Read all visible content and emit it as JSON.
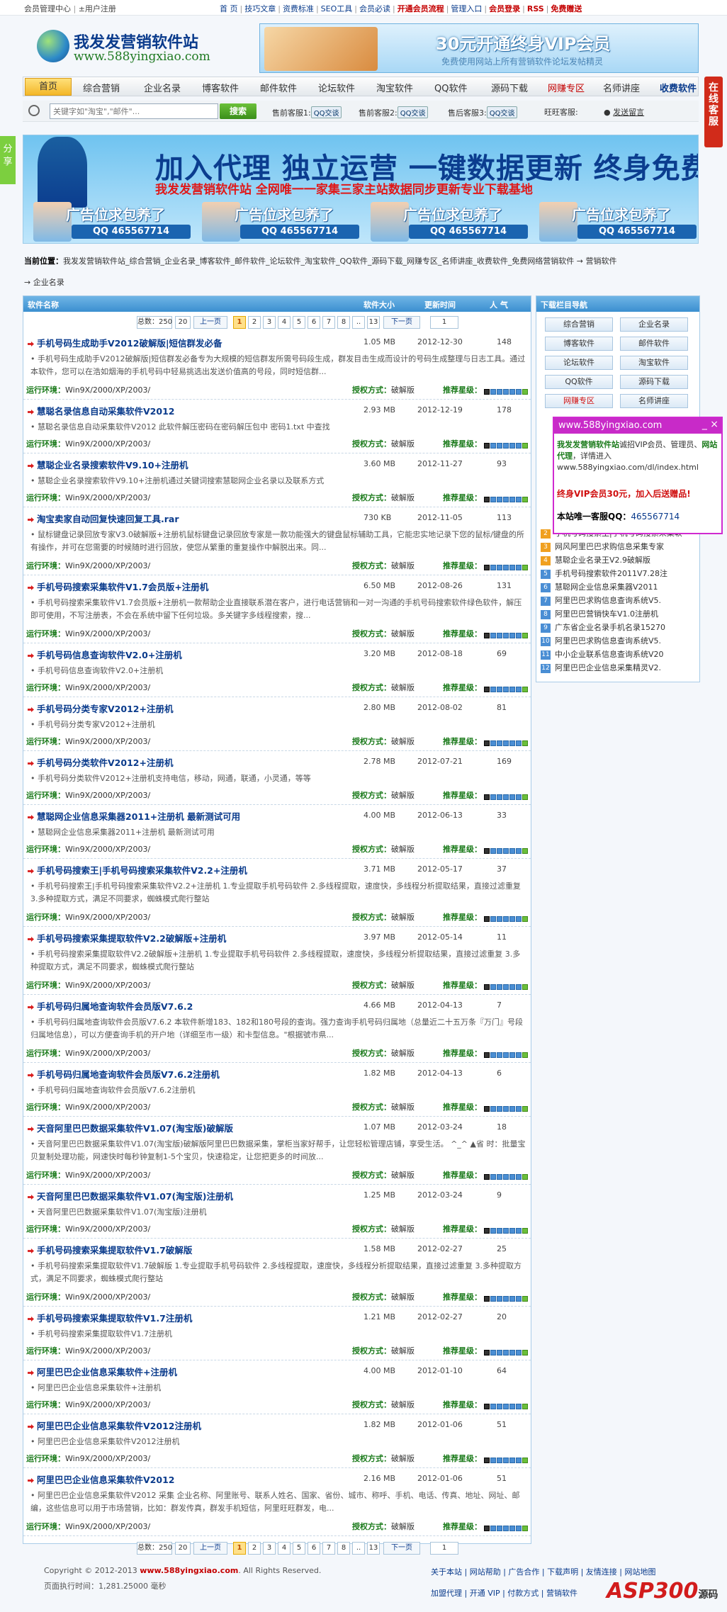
{
  "topbar": {
    "member_center": "会员管理中心",
    "register": "±用户注册",
    "links": [
      "首 页",
      "技巧文章",
      "资费标准",
      "SEO工具",
      "会员必读",
      "开通会员流程",
      "管理入口",
      "会员登录",
      "RSS",
      "免费赠送"
    ]
  },
  "logo": {
    "title": "我发发营销软件站",
    "url": "www.588yingxiao.com"
  },
  "vip_banner": {
    "headline": "30元开通终身VIP会员",
    "sub": "免费使用网站上所有营销软件论坛发帖精灵"
  },
  "nav": [
    "首页",
    "综合营销",
    "企业名录",
    "博客软件",
    "邮件软件",
    "论坛软件",
    "淘宝软件",
    "QQ软件",
    "源码下载",
    "网赚专区",
    "名师讲座",
    "收费软件"
  ],
  "search": {
    "placeholder": "关键字如\"淘宝\",\"邮件\"...",
    "button": "搜索"
  },
  "service": {
    "pre_sale1": "售前客服1:",
    "pre_sale2": "售前客服2:",
    "after_sale": "售后客服3:",
    "wangwang": "旺旺客服:",
    "qq_label": "QQ交谈",
    "leave_msg": "发送留言"
  },
  "side_float": "在线客服",
  "share": "分享",
  "big_ad": {
    "headline": "加入代理 独立运营 一键数据更新 终身免费",
    "sub": "我发发营销软件站 全网唯一一家集三家主站数据同步更新专业下载基地",
    "cells": [
      {
        "title": "广告位求包养了",
        "qq": "QQ 465567714"
      },
      {
        "title": "广告位求包养了",
        "qq": "QQ 465567714"
      },
      {
        "title": "广告位求包养了",
        "qq": "QQ 465567714"
      },
      {
        "title": "广告位求包养了",
        "qq": "QQ 465567714"
      }
    ]
  },
  "breadcrumb": {
    "label": "当前位置：",
    "path": "我发发营销软件站_综合营销_企业名录_博客软件_邮件软件_论坛软件_淘宝软件_QQ软件_源码下载_网赚专区_名师讲座_收费软件_免费网络营销软件 → 营销软件",
    "leaf": "→ 企业名录"
  },
  "list_header": {
    "name": "软件名称",
    "size": "软件大小",
    "time": "更新时间",
    "hits": "人 气"
  },
  "pager": {
    "total": "总数：250",
    "per": "20",
    "prev": "上一页",
    "pages": [
      "1",
      "2",
      "3",
      "4",
      "5",
      "6",
      "7",
      "8",
      "..",
      "13"
    ],
    "next": "下一页",
    "goto": "1"
  },
  "row_labels": {
    "env": "运行环境：",
    "auth": "授权方式：",
    "auth_value": "破解版",
    "rating": "推荐星级："
  },
  "items": [
    {
      "title": "手机号码生成助手V2012破解版|短信群发必备",
      "size": "1.05 MB",
      "date": "2012-12-30",
      "hits": "148",
      "desc": "• 手机号码生成助手V2012破解版|短信群发必备专为大规模的短信群发所需号码段生成，群发目击生成而设计的号码生成整理与日志工具。通过本软件，您可以在浩如烟海的手机号码中轻易挑选出发送价值高的号段，同时短信群...",
      "env": "Win9X/2000/XP/2003/"
    },
    {
      "title": "慧聪名录信息自动采集软件V2012",
      "size": "2.93 MB",
      "date": "2012-12-19",
      "hits": "178",
      "desc": "• 慧聪名录信息自动采集软件V2012 此软件解压密码在密码解压包中 密码1.txt 中查找",
      "env": "Win9X/2000/XP/2003/"
    },
    {
      "title": "慧聪企业名录搜索软件V9.10+注册机",
      "size": "3.60 MB",
      "date": "2012-11-27",
      "hits": "93",
      "desc": "• 慧聪企业名录搜索软件V9.10+注册机通过关键词搜索慧聪网企业名录以及联系方式",
      "env": "Win9X/2000/XP/2003/"
    },
    {
      "title": "淘宝卖家自动回复快速回复工具.rar",
      "size": "730 KB",
      "date": "2012-11-05",
      "hits": "113",
      "desc": "• 鼠标键盘记录回放专家V3.0破解版+注册机鼠标键盘记录回放专家是一款功能强大的键盘鼠标辅助工具，它能忠实地记录下您的鼠标/键盘的所有操作，并可在您需要的时候随时进行回放，使您从繁重的重复操作中解脱出来。同...",
      "env": "Win9X/2000/XP/2003/"
    },
    {
      "title": "手机号码搜索采集软件V1.7会员版+注册机",
      "size": "6.50 MB",
      "date": "2012-08-26",
      "hits": "131",
      "desc": "• 手机号码搜索采集软件V1.7会员版+注册机一款帮助企业直接联系潜在客户，进行电话营销和一对一沟通的手机号码搜索软件绿色软件，解压即可使用，不写注册表，不会在系统中留下任何垃圾。多关键字多线程搜索，搜...",
      "env": "Win9X/2000/XP/2003/"
    },
    {
      "title": "手机号码信息查询软件V2.0+注册机",
      "size": "3.20 MB",
      "date": "2012-08-18",
      "hits": "69",
      "desc": "• 手机号码信息查询软件V2.0+注册机",
      "env": "Win9X/2000/XP/2003/"
    },
    {
      "title": "手机号码分类专家V2012+注册机",
      "size": "2.80 MB",
      "date": "2012-08-02",
      "hits": "81",
      "desc": "• 手机号码分类专家V2012+注册机",
      "env": "Win9X/2000/XP/2003/"
    },
    {
      "title": "手机号码分类软件V2012+注册机",
      "size": "2.78 MB",
      "date": "2012-07-21",
      "hits": "169",
      "desc": "• 手机号码分类软件V2012+注册机支持电信，移动，网通，联通，小灵通，等等",
      "env": "Win9X/2000/XP/2003/"
    },
    {
      "title": "慧聪网企业信息采集器2011+注册机 最新测试可用",
      "size": "4.00 MB",
      "date": "2012-06-13",
      "hits": "33",
      "desc": "• 慧聪网企业信息采集器2011+注册机 最新测试可用",
      "env": "Win9X/2000/XP/2003/"
    },
    {
      "title": "手机号码搜索王|手机号码搜索采集软件V2.2+注册机",
      "size": "3.71 MB",
      "date": "2012-05-17",
      "hits": "37",
      "desc": "• 手机号码搜索王|手机号码搜索采集软件V2.2+注册机 1.专业提取手机号码软件 2.多线程提取，速度快，多线程分析提取结果，直接过滤重复 3.多种提取方式，满足不同要求，蜘蛛模式爬行整站",
      "env": "Win9X/2000/XP/2003/"
    },
    {
      "title": "手机号码搜索采集提取软件V2.2破解版+注册机",
      "size": "3.97 MB",
      "date": "2012-05-14",
      "hits": "11",
      "desc": "• 手机号码搜索采集提取软件V2.2破解版+注册机 1.专业提取手机号码软件 2.多线程提取，速度快，多线程分析提取结果，直接过滤重复 3.多种提取方式，满足不同要求，蜘蛛模式爬行整站",
      "env": "Win9X/2000/XP/2003/"
    },
    {
      "title": "手机号码归属地查询软件会员版V7.6.2",
      "size": "4.66 MB",
      "date": "2012-04-13",
      "hits": "7",
      "desc": "• 手机号码归属地查询软件会员版V7.6.2 本软件新增183、182和180号段的查询。强力查询手机号码归属地（总量近二十五万条『万门』号段归属地信息），可以方便查询手机的开户地（详细至市一级）和卡型信息。\"根据號市県...",
      "env": "Win9X/2000/XP/2003/"
    },
    {
      "title": "手机号码归属地查询软件会员版V7.6.2注册机",
      "size": "1.82 MB",
      "date": "2012-04-13",
      "hits": "6",
      "desc": "• 手机号码归属地查询软件会员版V7.6.2注册机",
      "env": "Win9X/2000/XP/2003/"
    },
    {
      "title": "天音阿里巴巴数据采集软件V1.07(淘宝版)破解版",
      "size": "1.07 MB",
      "date": "2012-03-24",
      "hits": "18",
      "desc": "• 天音阿里巴巴数据采集软件V1.07(淘宝版)破解版阿里巴巴数据采集，掌柜当家好帮手，让您轻松管理店铺，享受生活。 ^_^ ▲省 时：批量宝贝复制处理功能，网速快时每秒钟复制1-5个宝贝，快速稳定，让您把更多的时间放...",
      "env": "Win9X/2000/XP/2003/"
    },
    {
      "title": "天音阿里巴巴数据采集软件V1.07(淘宝版)注册机",
      "size": "1.25 MB",
      "date": "2012-03-24",
      "hits": "9",
      "desc": "• 天音阿里巴巴数据采集软件V1.07(淘宝版)注册机",
      "env": "Win9X/2000/XP/2003/"
    },
    {
      "title": "手机号码搜索采集提取软件V1.7破解版",
      "size": "1.58 MB",
      "date": "2012-02-27",
      "hits": "25",
      "desc": "• 手机号码搜索采集提取软件V1.7破解版 1.专业提取手机号码软件 2.多线程提取，速度快，多线程分析提取结果，直接过滤重复 3.多种提取方式，满足不同要求，蜘蛛模式爬行整站",
      "env": "Win9X/2000/XP/2003/"
    },
    {
      "title": "手机号码搜索采集提取软件V1.7注册机",
      "size": "1.21 MB",
      "date": "2012-02-27",
      "hits": "20",
      "desc": "• 手机号码搜索采集提取软件V1.7注册机",
      "env": "Win9X/2000/XP/2003/"
    },
    {
      "title": "阿里巴巴企业信息采集软件+注册机",
      "size": "4.00 MB",
      "date": "2012-01-10",
      "hits": "64",
      "desc": "• 阿里巴巴企业信息采集软件+注册机",
      "env": "Win9X/2000/XP/2003/"
    },
    {
      "title": "阿里巴巴企业信息采集软件V2012注册机",
      "size": "1.82 MB",
      "date": "2012-01-06",
      "hits": "51",
      "desc": "• 阿里巴巴企业信息采集软件V2012注册机",
      "env": "Win9X/2000/XP/2003/"
    },
    {
      "title": "阿里巴巴企业信息采集软件V2012",
      "size": "2.16 MB",
      "date": "2012-01-06",
      "hits": "51",
      "desc": "• 阿里巴巴企业信息采集软件V2012 采集 企业名称、阿里账号、联系人姓名、国家、省份、城市、称呼、手机、电话、传真、地址、网址、邮编，这些信息可以用于市场营销，比如：群发传真，群发手机短信，阿里旺旺群发，电...",
      "env": "Win9X/2000/XP/2003/"
    }
  ],
  "sidebar": {
    "title": "下载栏目导航",
    "cats": [
      "综合营销",
      "企业名录",
      "博客软件",
      "邮件软件",
      "论坛软件",
      "淘宝软件",
      "QQ软件",
      "源码下载",
      "网赚专区",
      "名师讲座"
    ],
    "ranks": [
      "手机号码搜索王|手机号码搜索采集软",
      "网风阿里巴巴求购信息采集专家",
      "慧聪企业名录王V2.9破解版",
      "手机号码搜索软件2011V7.28注",
      "慧聪网企业信息采集器V2011",
      "阿里巴巴求购信息查询系统V5.",
      "阿里巴巴营销快车V1.0注册机",
      "广东省企业名录手机名录15270",
      "阿里巴巴求购信息查询系统V5.",
      "中小企业联系信息查询系统V20",
      "阿里巴巴企业信息采集精灵V2."
    ]
  },
  "popup": {
    "title": "www.588yingxiao.com",
    "body_b": "我发发营销软件站",
    "body1": "诚招VIP会员、管理员、",
    "body_b2": "网站代理",
    "body2": "，详情进入 www.588yingxiao.com/dl/index.html",
    "price": "终身VIP会员30元，加入后送赠品!",
    "qq_label": "本站唯一客服QQ：",
    "qq": "465567714"
  },
  "footer": {
    "copy": "Copyright © 2012-2013 ",
    "site": "www.588yingxiao.com",
    "rights": ". All Rights Reserved.",
    "runtime": "页面执行时间：1,281.25000 毫秒",
    "links1": "关于本站 | 网站帮助 | 广告合作 | 下载声明 | 友情连接 | 网站地图",
    "links2": "加盟代理 | 开通 VIP | 付款方式 | 营销软件"
  },
  "watermark": {
    "text": "ASP300",
    "small": "源码"
  }
}
